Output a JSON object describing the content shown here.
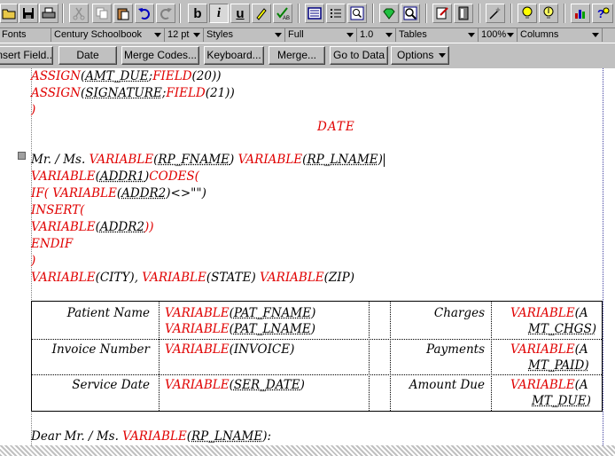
{
  "toolbar": {
    "buttons": [
      "open-icon",
      "save-icon",
      "print-icon",
      "cut-icon",
      "copy-icon",
      "paste-icon",
      "undo-icon",
      "redo-icon",
      "bold-icon",
      "italic-icon",
      "underline-icon",
      "highlight-icon",
      "spellcheck-icon",
      "columns-icon",
      "bullets-icon",
      "zoom-icon",
      "gem-icon",
      "find-icon",
      "merge-icon",
      "book-icon",
      "magic-icon",
      "bulb-icon",
      "idea-icon",
      "chart-icon",
      "help-icon"
    ],
    "bold": "b",
    "italic": "i",
    "underline": "u"
  },
  "format_bar": {
    "fonts_label": "Fonts",
    "font_name": "Century Schoolbook",
    "font_size": "12 pt",
    "styles": "Styles",
    "justification": "Full",
    "line_spacing": "1.0",
    "tables": "Tables",
    "zoom": "100%",
    "columns": "Columns"
  },
  "button_bar": {
    "insert_field": "Insert Field...",
    "date": "Date",
    "merge_codes": "Merge Codes...",
    "keyboard": "Keyboard...",
    "merge": "Merge...",
    "go_to_data": "Go to Data",
    "options": "Options"
  },
  "document": {
    "lines": [
      {
        "kw1": "ASSIGN",
        "t1": "(",
        "u1": "AMT_DUE",
        "t2": ";",
        "kw2": "FIELD",
        "t3": "(20))"
      },
      {
        "kw1": "ASSIGN",
        "t1": "(",
        "u1": "SIGNATURE",
        "t2": ";",
        "kw2": "FIELD",
        "t3": "(21))"
      }
    ],
    "close_paren": ")",
    "date_code": "DATE",
    "salutation_line": {
      "prefix": "Mr. / Ms. ",
      "kw": "VARIABLE",
      "a": "(",
      "u1": "RP_FNAME",
      "b": ") ",
      "kw2": "VARIABLE",
      "c": "(",
      "u2": "RP_LNAME",
      "d": ")"
    },
    "addr1": {
      "kw": "VARIABLE",
      "a": "(",
      "u": "ADDR1",
      "b": ")",
      "kw2": "CODES("
    },
    "if_line": {
      "kw": "IF( ",
      "kw2": "VARIABLE",
      "a": "(",
      "u": "ADDR2",
      "b": ")<>\"\")"
    },
    "insert_kw": "INSERT(",
    "addr2": {
      "kw": "VARIABLE",
      "a": "(",
      "u": "ADDR2",
      "b": "))"
    },
    "endif_kw": "ENDIF",
    "city_line": {
      "kw": "VARIABLE",
      "a": "(CITY), ",
      "kw2": "VARIABLE",
      "b": "(STATE)  ",
      "kw3": "VARIABLE",
      "c": "(ZIP)"
    },
    "table": {
      "rows": [
        {
          "label": "Patient Name",
          "kw": "VARIABLE",
          "a": "(",
          "u": "PAT_FNAME",
          "b": ")",
          "kw2": "VARIABLE",
          "c": "(",
          "u2": "PAT_LNAME",
          "d": ")",
          "label2": "Charges",
          "kw3": "VARIABLE",
          "e": "(A",
          "f": "MT_CHGS)"
        },
        {
          "label": "Invoice Number",
          "kw": "VARIABLE",
          "a": "(INVOICE)",
          "label2": "Payments",
          "kw3": "VARIABLE",
          "e": "(A",
          "f": "MT_PAID)"
        },
        {
          "label": "Service Date",
          "kw": "VARIABLE",
          "a": "(",
          "u": "SER_DATE",
          "b": ")",
          "label2": "Amount Due",
          "kw3": "VARIABLE",
          "e": "(A",
          "f": "MT_DUE)"
        }
      ]
    },
    "dear_line": {
      "prefix": "Dear Mr. / Ms. ",
      "kw": "VARIABLE",
      "a": "(",
      "u": "RP_LNAME",
      "b": "):"
    }
  }
}
